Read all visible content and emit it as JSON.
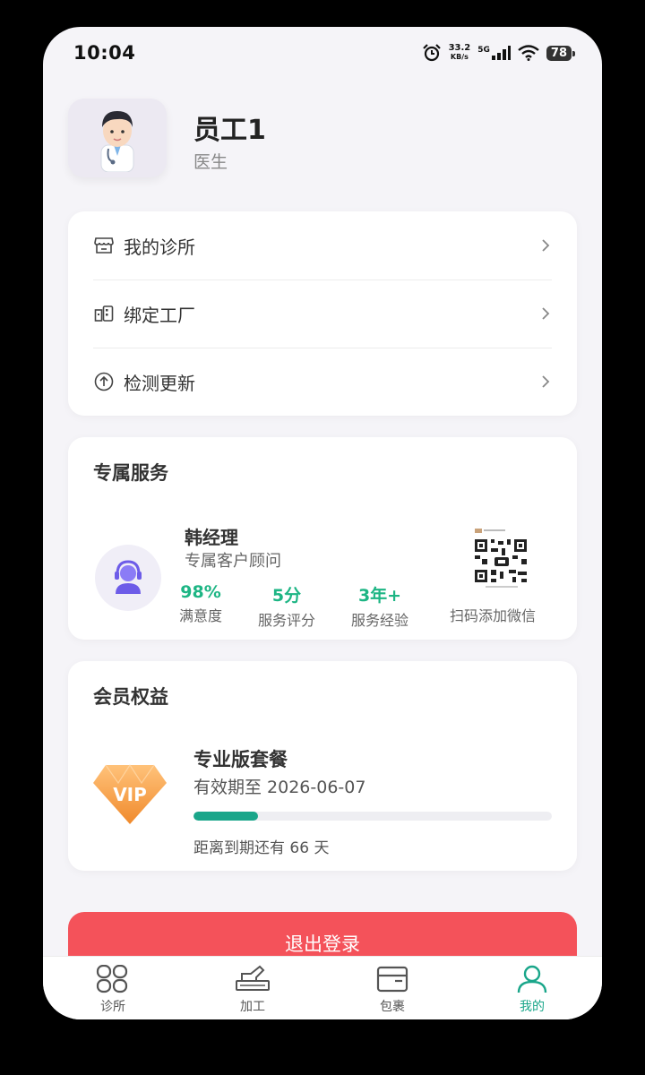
{
  "status_bar": {
    "time": "10:04",
    "net_speed_value": "33.2",
    "net_speed_unit": "KB/s",
    "network": "5G",
    "battery": "78"
  },
  "profile": {
    "name": "员工1",
    "role": "医生",
    "avatar_icon": "doctor-avatar-icon"
  },
  "menu": {
    "items": [
      {
        "label": "我的诊所",
        "icon": "store-icon"
      },
      {
        "label": "绑定工厂",
        "icon": "factory-icon"
      },
      {
        "label": "检测更新",
        "icon": "upload-circle-icon"
      }
    ]
  },
  "service": {
    "title": "专属服务",
    "manager_name": "韩经理",
    "manager_role": "专属客户顾问",
    "stats": [
      {
        "value": "98%",
        "label": "满意度"
      },
      {
        "value": "5分",
        "label": "服务评分"
      },
      {
        "value": "3年+",
        "label": "服务经验"
      }
    ],
    "qr_label": "扫码添加微信"
  },
  "membership": {
    "title": "会员权益",
    "badge_text": "VIP",
    "plan_name": "专业版套餐",
    "expiry": "有效期至 2026-06-07",
    "remaining": "距离到期还有 66 天",
    "progress": 0.18
  },
  "logout_label": "退出登录",
  "tabbar": {
    "tabs": [
      {
        "label": "诊所",
        "icon": "grid-icon",
        "active": false
      },
      {
        "label": "加工",
        "icon": "machine-icon",
        "active": false
      },
      {
        "label": "包裹",
        "icon": "package-icon",
        "active": false
      },
      {
        "label": "我的",
        "icon": "user-icon",
        "active": true
      }
    ]
  },
  "colors": {
    "accent": "#1aa68a",
    "stat_green": "#1db584",
    "logout_red": "#f4525a",
    "vip_orange": "#f5a349"
  }
}
